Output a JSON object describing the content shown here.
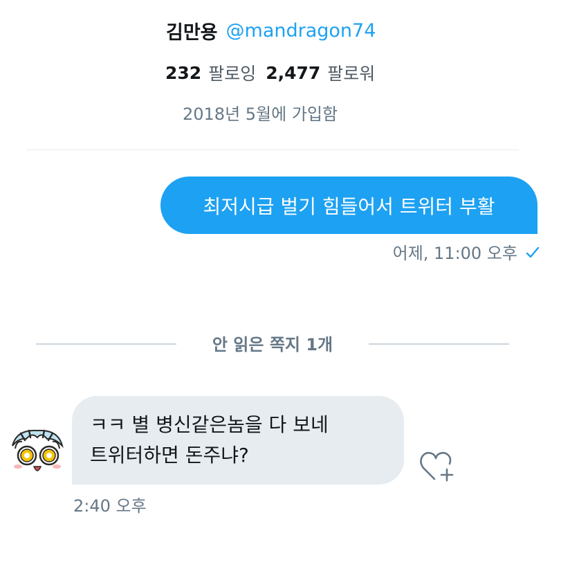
{
  "profile": {
    "display_name": "김만용",
    "handle": "@mandragon74",
    "following_count": "232",
    "following_label": "팔로잉",
    "followers_count": "2,477",
    "followers_label": "팔로워",
    "joined": "2018년 5월에 가입함"
  },
  "messages": {
    "sent": {
      "text": "최저시급 벌기 힘들어서 트위터 부활",
      "time": "어제, 11:00 오후",
      "status_icon": "checkmark-icon"
    },
    "unread_divider": "안 읽은 쪽지 1개",
    "received": {
      "lines": [
        "ㅋㅋ 별 병신같은놈을 다 보네",
        "트위터하면 돈주냐?"
      ],
      "time": "2:40 오후",
      "like_icon": "heart-plus-icon",
      "avatar_icon": "cartoon-face-avatar"
    }
  },
  "colors": {
    "accent": "#1da1f2",
    "bubble_received": "#e6ecf0",
    "muted_text": "#657786",
    "divider": "#ccd6dd"
  }
}
